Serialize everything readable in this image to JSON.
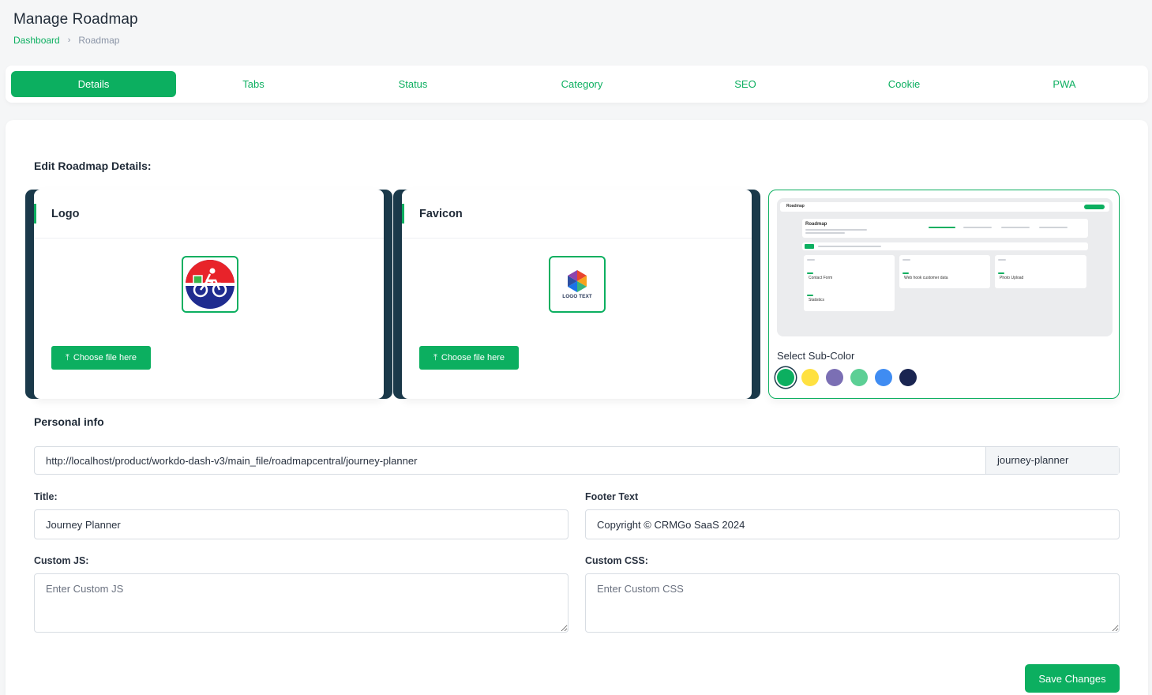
{
  "header": {
    "title": "Manage Roadmap",
    "breadcrumb": {
      "home": "Dashboard",
      "separator": "›",
      "current": "Roadmap"
    }
  },
  "tabs": [
    {
      "label": "Details",
      "active": true
    },
    {
      "label": "Tabs",
      "active": false
    },
    {
      "label": "Status",
      "active": false
    },
    {
      "label": "Category",
      "active": false
    },
    {
      "label": "SEO",
      "active": false
    },
    {
      "label": "Cookie",
      "active": false
    },
    {
      "label": "PWA",
      "active": false
    }
  ],
  "section_title": "Edit Roadmap Details:",
  "logo_card": {
    "title": "Logo",
    "button_label": "Choose file here",
    "button_icon": "upload-icon"
  },
  "favicon_card": {
    "title": "Favicon",
    "button_label": "Choose file here",
    "button_icon": "upload-icon",
    "logo_text": "LOGO TEXT"
  },
  "theme": {
    "sub_color_label": "Select Sub-Color",
    "colors": [
      "#0caf60",
      "#ffe141",
      "#7b6fb4",
      "#5ccf95",
      "#3f8cf2",
      "#1a2551"
    ],
    "selected_index": 0,
    "preview": {
      "brand": "Roadmap",
      "heading": "Roadmap",
      "columns": [
        "Contact Form",
        "Web hook customer data",
        "Photo Upload",
        "Statistics"
      ]
    }
  },
  "personal_info": {
    "heading": "Personal info",
    "url_value": "http://localhost/product/workdo-dash-v3/main_file/roadmapcentral/journey-planner",
    "slug": "journey-planner"
  },
  "form": {
    "title_label": "Title:",
    "title_value": "Journey Planner",
    "footer_label": "Footer Text",
    "footer_value": "Copyright © CRMGo SaaS 2024",
    "js_label": "Custom JS:",
    "js_placeholder": "Enter Custom JS",
    "css_label": "Custom CSS:",
    "css_placeholder": "Enter Custom CSS"
  },
  "save_label": "Save Changes"
}
